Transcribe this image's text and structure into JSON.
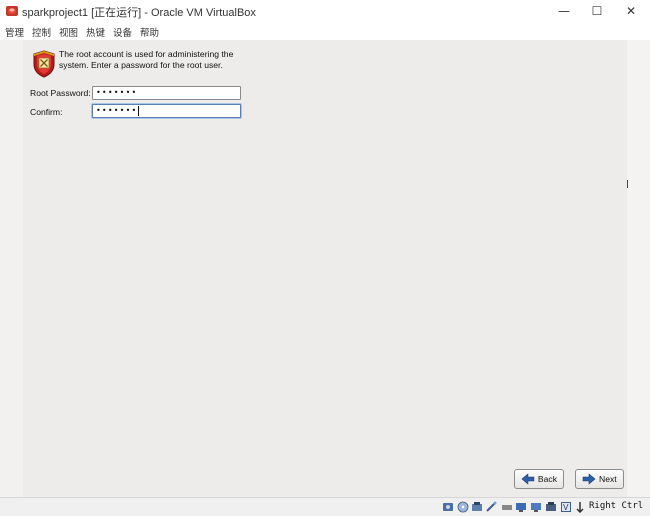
{
  "window": {
    "title": "sparkproject1 [正在运行] - Oracle VM VirtualBox",
    "minimize_glyph": "—",
    "maximize_glyph": "☐",
    "close_glyph": "✕"
  },
  "menu": [
    "管理",
    "控制",
    "视图",
    "热键",
    "设备",
    "帮助"
  ],
  "installer": {
    "intro_text": "The root account is used for administering the system.  Enter a password for the root user.",
    "root_password": {
      "label": "Root Password:",
      "masked_value": "•••••••"
    },
    "confirm": {
      "label": "Confirm:",
      "masked_value": "•••••••"
    },
    "back_label": "Back",
    "next_label": "Next"
  },
  "statusbar": {
    "icons": [
      "hard-disk-icon",
      "optical-drive-icon",
      "audio-icon",
      "network-icon",
      "usb-icon",
      "shared-folders-icon",
      "display-icon",
      "video-capture-icon",
      "virtualization-icon",
      "keyboard-icon",
      "mouse-icon"
    ],
    "host_key": "Right Ctrl"
  },
  "colors": {
    "installer_bg": "#edeceb",
    "focus_border": "#5a7fb0",
    "arrow_blue": "#2f5fa8"
  }
}
